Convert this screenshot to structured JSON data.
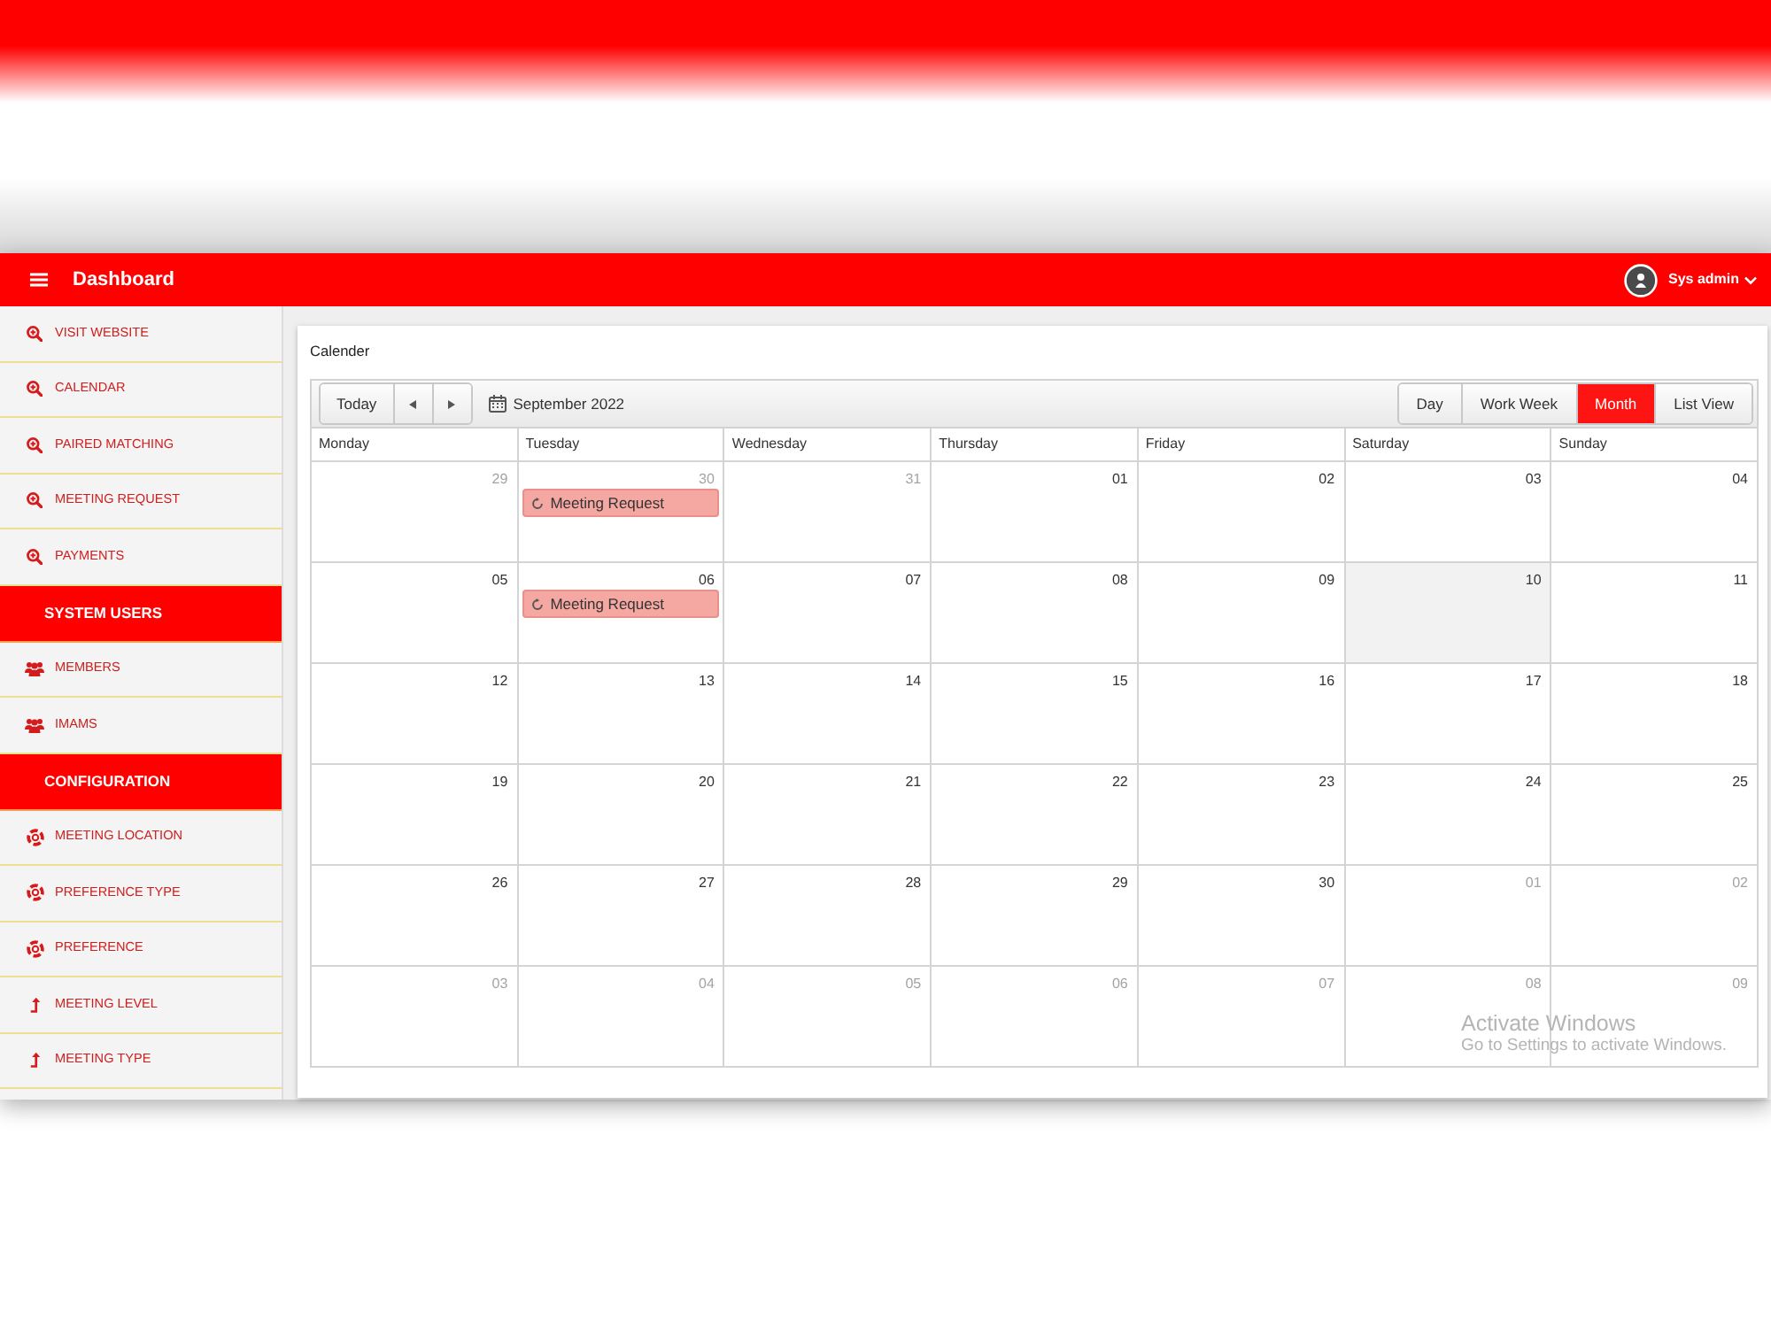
{
  "header": {
    "title": "Dashboard",
    "user": "Sys admin"
  },
  "sidebar": {
    "items": [
      {
        "kind": "search",
        "label": "VISIT WEBSITE"
      },
      {
        "kind": "search",
        "label": "CALENDAR"
      },
      {
        "kind": "search",
        "label": "PAIRED MATCHING"
      },
      {
        "kind": "search",
        "label": "MEETING REQUEST"
      },
      {
        "kind": "search",
        "label": "PAYMENTS"
      },
      {
        "kind": "heading",
        "label": "SYSTEM USERS"
      },
      {
        "kind": "users",
        "label": "MEMBERS"
      },
      {
        "kind": "users",
        "label": "IMAMS"
      },
      {
        "kind": "heading",
        "label": "CONFIGURATION"
      },
      {
        "kind": "config",
        "label": "MEETING LOCATION"
      },
      {
        "kind": "config",
        "label": "PREFERENCE TYPE"
      },
      {
        "kind": "config",
        "label": "PREFERENCE"
      },
      {
        "kind": "level",
        "label": "MEETING LEVEL"
      },
      {
        "kind": "level",
        "label": "MEETING TYPE"
      }
    ]
  },
  "calendar": {
    "title": "Calender",
    "today_button": "Today",
    "period": "September 2022",
    "views": [
      {
        "label": "Day",
        "selected": false
      },
      {
        "label": "Work Week",
        "selected": false
      },
      {
        "label": "Month",
        "selected": true
      },
      {
        "label": "List View",
        "selected": false
      }
    ],
    "weekdays": [
      "Monday",
      "Tuesday",
      "Wednesday",
      "Thursday",
      "Friday",
      "Saturday",
      "Sunday"
    ],
    "weeks": [
      {
        "days": [
          {
            "date": "29",
            "other_month": true,
            "today": false
          },
          {
            "date": "30",
            "other_month": true,
            "today": false,
            "events": [
              {
                "title": "Meeting Request"
              }
            ]
          },
          {
            "date": "31",
            "other_month": true,
            "today": false
          },
          {
            "date": "01",
            "other_month": false,
            "today": false
          },
          {
            "date": "02",
            "other_month": false,
            "today": false
          },
          {
            "date": "03",
            "other_month": false,
            "today": false
          },
          {
            "date": "04",
            "other_month": false,
            "today": false
          }
        ]
      },
      {
        "days": [
          {
            "date": "05",
            "other_month": false,
            "today": false
          },
          {
            "date": "06",
            "other_month": false,
            "today": false,
            "events": [
              {
                "title": "Meeting Request"
              }
            ]
          },
          {
            "date": "07",
            "other_month": false,
            "today": false
          },
          {
            "date": "08",
            "other_month": false,
            "today": false
          },
          {
            "date": "09",
            "other_month": false,
            "today": false
          },
          {
            "date": "10",
            "other_month": false,
            "today": true
          },
          {
            "date": "11",
            "other_month": false,
            "today": false
          }
        ]
      },
      {
        "days": [
          {
            "date": "12",
            "other_month": false,
            "today": false
          },
          {
            "date": "13",
            "other_month": false,
            "today": false
          },
          {
            "date": "14",
            "other_month": false,
            "today": false
          },
          {
            "date": "15",
            "other_month": false,
            "today": false
          },
          {
            "date": "16",
            "other_month": false,
            "today": false
          },
          {
            "date": "17",
            "other_month": false,
            "today": false
          },
          {
            "date": "18",
            "other_month": false,
            "today": false
          }
        ]
      },
      {
        "days": [
          {
            "date": "19",
            "other_month": false,
            "today": false
          },
          {
            "date": "20",
            "other_month": false,
            "today": false
          },
          {
            "date": "21",
            "other_month": false,
            "today": false
          },
          {
            "date": "22",
            "other_month": false,
            "today": false
          },
          {
            "date": "23",
            "other_month": false,
            "today": false
          },
          {
            "date": "24",
            "other_month": false,
            "today": false
          },
          {
            "date": "25",
            "other_month": false,
            "today": false
          }
        ]
      },
      {
        "days": [
          {
            "date": "26",
            "other_month": false,
            "today": false
          },
          {
            "date": "27",
            "other_month": false,
            "today": false
          },
          {
            "date": "28",
            "other_month": false,
            "today": false
          },
          {
            "date": "29",
            "other_month": false,
            "today": false
          },
          {
            "date": "30",
            "other_month": false,
            "today": false
          },
          {
            "date": "01",
            "other_month": true,
            "today": false
          },
          {
            "date": "02",
            "other_month": true,
            "today": false
          }
        ]
      },
      {
        "days": [
          {
            "date": "03",
            "other_month": true,
            "today": false
          },
          {
            "date": "04",
            "other_month": true,
            "today": false
          },
          {
            "date": "05",
            "other_month": true,
            "today": false
          },
          {
            "date": "06",
            "other_month": true,
            "today": false
          },
          {
            "date": "07",
            "other_month": true,
            "today": false
          },
          {
            "date": "08",
            "other_month": true,
            "today": false
          },
          {
            "date": "09",
            "other_month": true,
            "today": false
          }
        ]
      }
    ]
  },
  "activation_notice": {
    "title": "Activate Windows",
    "text": "Go to Settings to activate Windows."
  }
}
